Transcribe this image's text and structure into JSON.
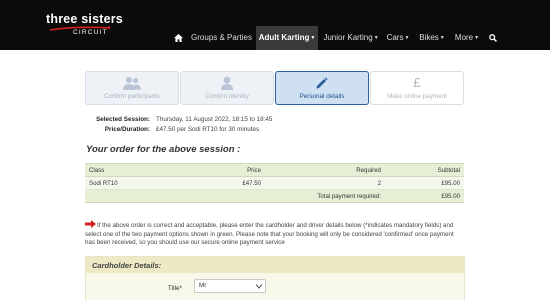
{
  "brand": {
    "name": "three sisters",
    "sub": "CIRCUIT"
  },
  "nav": {
    "home_icon": "home-icon",
    "items": [
      {
        "label": "Groups & Parties",
        "dropdown": false,
        "active": false
      },
      {
        "label": "Adult Karting",
        "dropdown": true,
        "active": true
      },
      {
        "label": "Junior Karting",
        "dropdown": true,
        "active": false
      },
      {
        "label": "Cars",
        "dropdown": true,
        "active": false
      },
      {
        "label": "Bikes",
        "dropdown": true,
        "active": false
      },
      {
        "label": "More",
        "dropdown": true,
        "active": false
      }
    ],
    "search_icon": "search-icon"
  },
  "steps": [
    {
      "label": "Confirm participants",
      "icon": "users-icon",
      "state": "done"
    },
    {
      "label": "Confirm identity",
      "icon": "user-icon",
      "state": "done"
    },
    {
      "label": "Personal details",
      "icon": "pencil-icon",
      "state": "active"
    },
    {
      "label": "Make online payment",
      "icon": "pound-icon",
      "state": "pending"
    }
  ],
  "session": {
    "selected_label": "Selected Session:",
    "selected_value": "Thursday, 11 August 2022, 18:15 to 18:45",
    "price_label": "Price/Duration:",
    "price_value": "£47.50 per Sodi RT10 for 30 minutes"
  },
  "order": {
    "title": "Your order for the above session :",
    "columns": [
      "Class",
      "Price",
      "Required",
      "Subtotal"
    ],
    "rows": [
      {
        "class": "Sodi RT10",
        "price": "£47.50",
        "required": "2",
        "subtotal": "£95.00"
      }
    ],
    "total_label": "Total payment required:",
    "total_value": "£95.00"
  },
  "note": "If the above order is correct and acceptable, please enter the cardholder and driver details below (*indicates mandatory fields) and select one of the two payment options shown in green. Please note that your booking will only be considered 'confirmed' once payment has been received, so you should use our secure online payment service",
  "cardholder": {
    "title": "Cardholder Details:",
    "title_field_label": "Title*",
    "title_field_value": "Mr"
  },
  "colors": {
    "header_bg": "#0b0b0b",
    "active_step": "#cfe0f3",
    "table_header": "#e6eed6",
    "arrow": "#d21f1f",
    "card_head": "#ece9c4"
  }
}
